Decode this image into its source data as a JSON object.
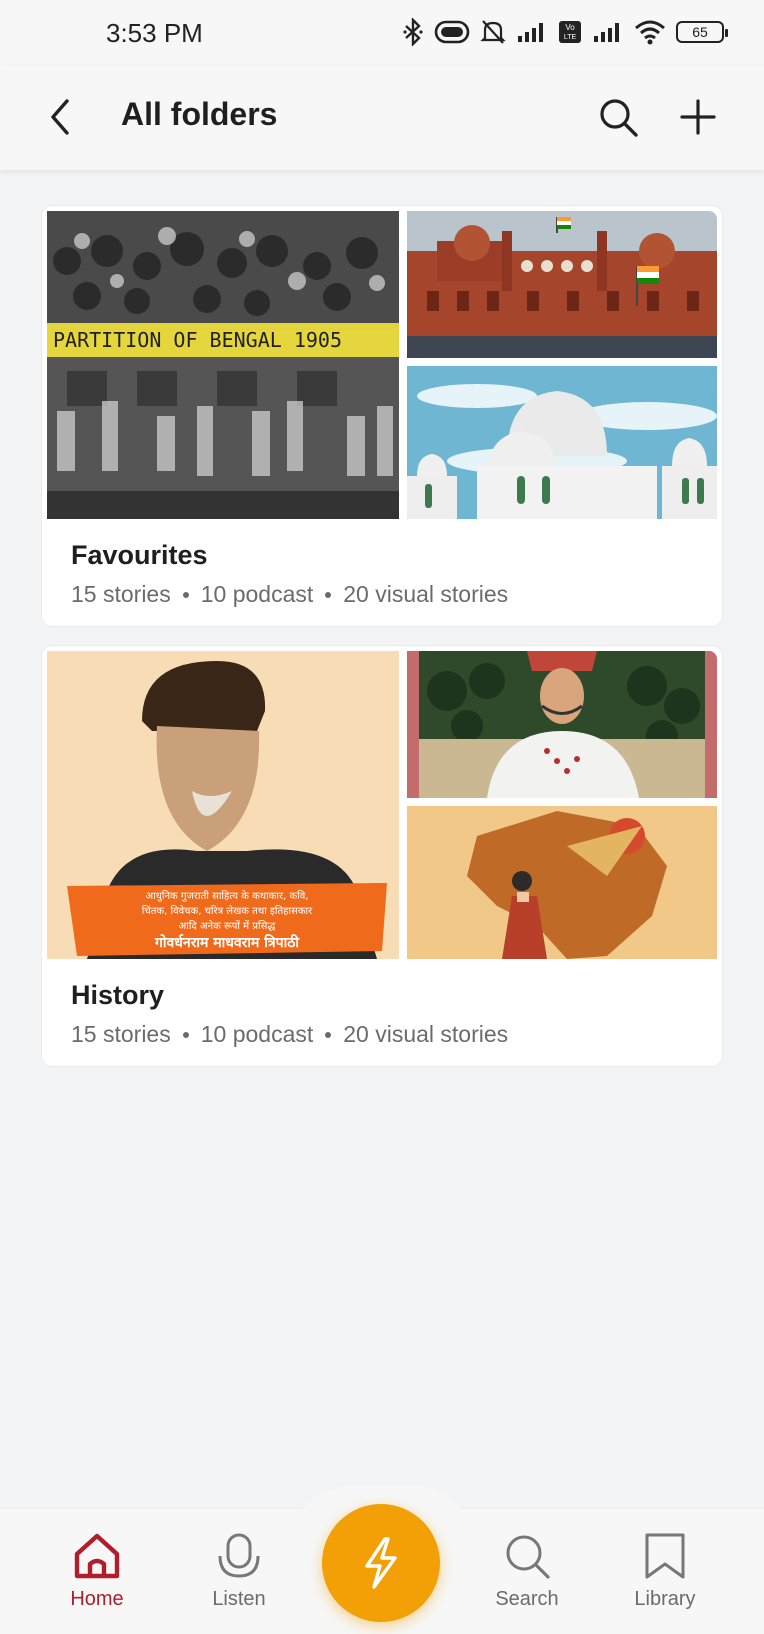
{
  "status_bar": {
    "time": "3:53 PM",
    "battery": "65",
    "icons": [
      "bluetooth-icon",
      "data-saver-icon",
      "mute-icon",
      "signal-icon",
      "volte-icon",
      "signal-icon",
      "wifi-icon",
      "battery-icon"
    ]
  },
  "header": {
    "title": "All folders",
    "back_icon": "chevron-left-icon",
    "search_icon": "search-icon",
    "add_icon": "plus-icon"
  },
  "folders": [
    {
      "title": "Favourites",
      "stats": [
        "15 stories",
        "10 podcast",
        "20 visual stories"
      ],
      "thumb_text": "PARTITION OF BENGAL 1905"
    },
    {
      "title": "History",
      "stats": [
        "15 stories",
        "10 podcast",
        "20 visual stories"
      ],
      "thumb_text_lines": [
        "आधुनिक गुजराती साहित्य के कथाकार, कवि,",
        "चिंतक, विवेचक, चरित्र लेखक तथा इतिहासकार",
        "आदि अनेक रूपों में प्रसिद्ध",
        "गोवर्धनराम माधवराम त्रिपाठी"
      ]
    }
  ],
  "bottom_nav": {
    "items": [
      {
        "label": "Home",
        "icon": "home-icon",
        "active": true
      },
      {
        "label": "Listen",
        "icon": "microphone-icon",
        "active": false
      },
      {
        "label": "Search",
        "icon": "search-icon",
        "active": false
      },
      {
        "label": "Library",
        "icon": "bookmark-icon",
        "active": false
      }
    ],
    "fab_icon": "lightning-icon"
  },
  "colors": {
    "accent": "#b01d2b",
    "fab": "#f2a006",
    "background": "#f3f4f6"
  }
}
